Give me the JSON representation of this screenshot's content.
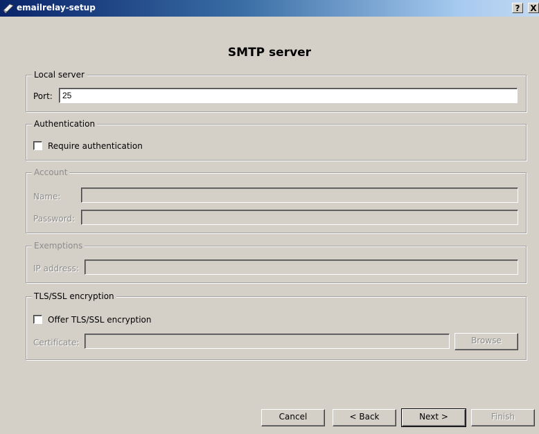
{
  "window": {
    "title": "emailrelay-setup",
    "help_label": "?",
    "close_label": "X"
  },
  "page": {
    "title": "SMTP server"
  },
  "local_server": {
    "legend": "Local server",
    "port_label": "Port:",
    "port_value": "25"
  },
  "authentication": {
    "legend": "Authentication",
    "require_label": "Require authentication",
    "require_checked": false
  },
  "account": {
    "legend": "Account",
    "name_label": "Name:",
    "name_value": "",
    "password_label": "Password:",
    "password_value": ""
  },
  "exemptions": {
    "legend": "Exemptions",
    "ip_label": "IP address:",
    "ip_value": ""
  },
  "tls": {
    "legend": "TLS/SSL encryption",
    "offer_label": "Offer TLS/SSL encryption",
    "offer_checked": false,
    "certificate_label": "Certificate:",
    "certificate_value": "",
    "browse_label": "Browse"
  },
  "buttons": {
    "cancel": "Cancel",
    "back": "< Back",
    "next": "Next >",
    "finish": "Finish"
  }
}
